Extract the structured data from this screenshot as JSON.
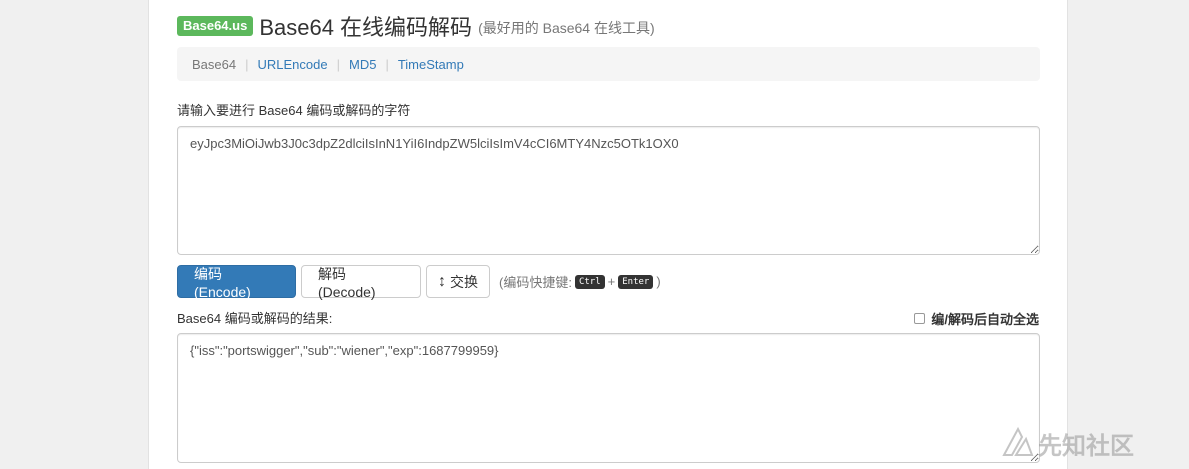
{
  "header": {
    "logo": "Base64.us",
    "title": "Base64 在线编码解码",
    "subtitle": "(最好用的 Base64 在线工具)"
  },
  "nav": {
    "items": [
      {
        "label": "Base64",
        "active": true
      },
      {
        "label": "URLEncode",
        "active": false
      },
      {
        "label": "MD5",
        "active": false
      },
      {
        "label": "TimeStamp",
        "active": false
      }
    ],
    "separator": "|"
  },
  "input": {
    "label": "请输入要进行 Base64 编码或解码的字符",
    "value": "eyJpc3MiOiJwb3J0c3dpZ2dlciIsInN1YiI6IndpZW5lciIsImV4cCI6MTY4Nzc5OTk1OX0"
  },
  "buttons": {
    "encode": "编码 (Encode)",
    "decode": "解码 (Decode)",
    "swap_icon": "↕",
    "swap": "交换"
  },
  "shortcut": {
    "prefix": "(编码快捷键:",
    "key1": "Ctrl",
    "plus": "+",
    "key2": "Enter",
    "suffix": ")"
  },
  "result": {
    "label": "Base64 编码或解码的结果:",
    "autoselect_label": "编/解码后自动全选",
    "autoselect_checked": false,
    "value": "{\"iss\":\"portswigger\",\"sub\":\"wiener\",\"exp\":1687799959}"
  },
  "watermark": {
    "text": "先知社区"
  },
  "colors": {
    "logo_green": "#5cb85c",
    "primary_blue": "#337ab7",
    "link_blue": "#337ab7",
    "nav_bg": "#f5f5f5"
  }
}
